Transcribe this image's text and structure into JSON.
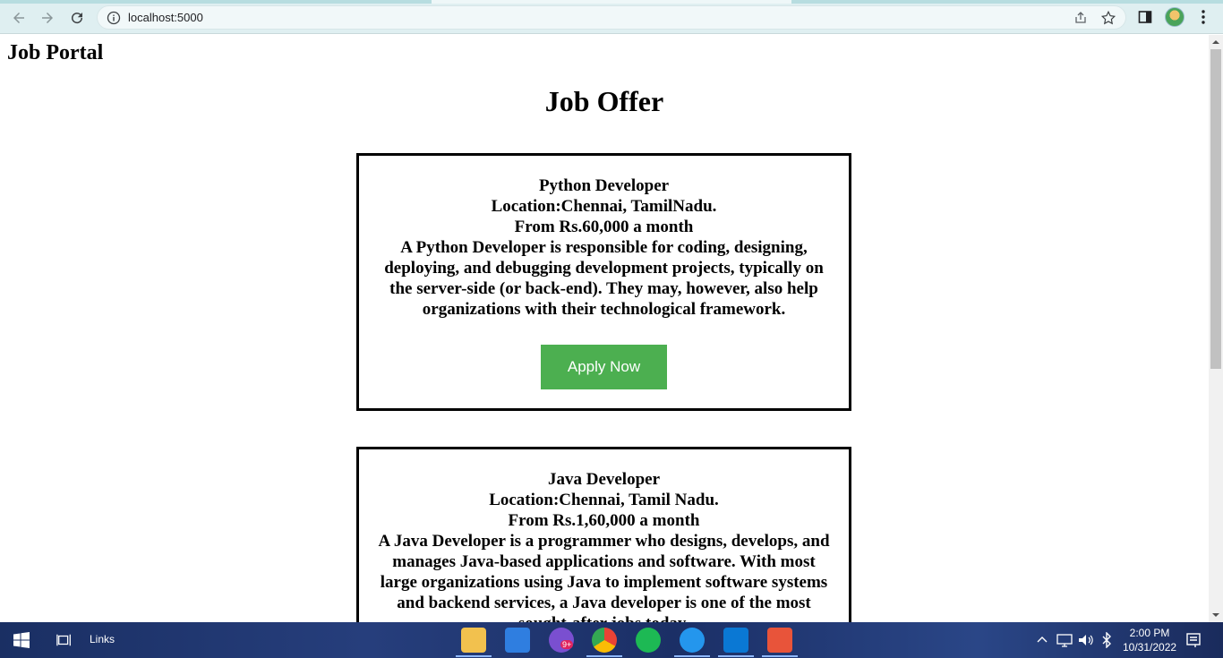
{
  "browser": {
    "url": "localhost:5000"
  },
  "page": {
    "site_name": "Job Portal",
    "title": "Job Offer"
  },
  "jobs": [
    {
      "title": "Python Developer",
      "location": "Location:Chennai, TamilNadu.",
      "salary": "From Rs.60,000 a month",
      "description": "A Python Developer is responsible for coding, designing, deploying, and debugging development projects, typically on the server-side (or back-end). They may, however, also help organizations with their technological framework.",
      "apply_label": "Apply Now"
    },
    {
      "title": "Java Developer",
      "location": "Location:Chennai, Tamil Nadu.",
      "salary": "From Rs.1,60,000 a month",
      "description": "A Java Developer is a programmer who designs, develops, and manages Java-based applications and software. With most large organizations using Java to implement software systems and backend services, a Java developer is one of the most sought-after jobs today."
    }
  ],
  "taskbar": {
    "links_label": "Links",
    "time": "2:00 PM",
    "date": "10/31/2022",
    "notification_badge": "9+"
  },
  "colors": {
    "apply_button": "#4caf50",
    "chrome_bg": "#dfeff1"
  }
}
